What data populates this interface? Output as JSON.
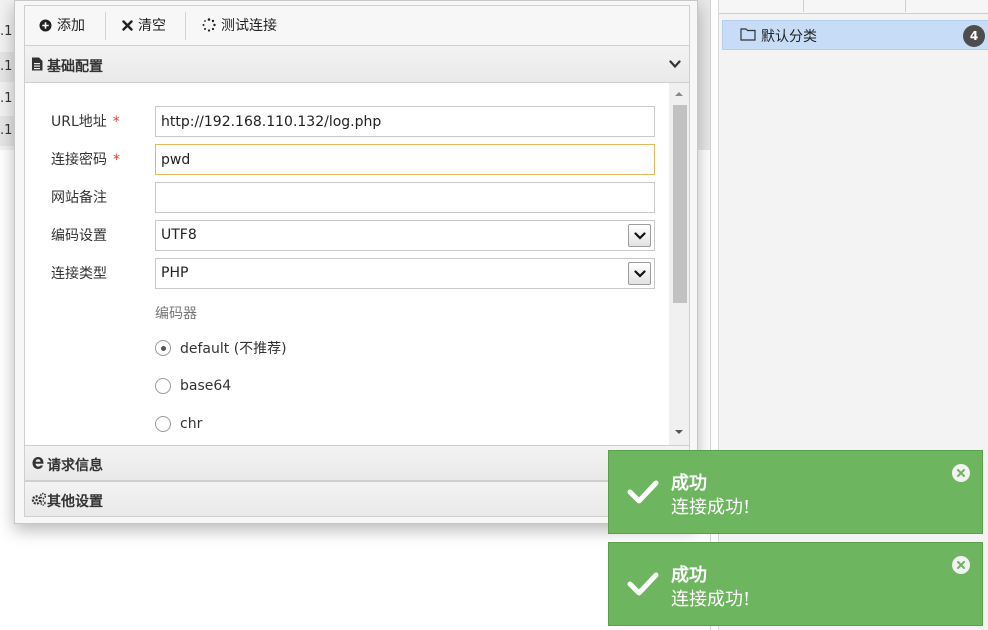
{
  "toolbar": {
    "add_label": "添加",
    "clear_label": "清空",
    "test_label": "测试连接"
  },
  "sections": {
    "basic_title": "基础配置",
    "request_title": "请求信息",
    "other_title": "其他设置"
  },
  "form": {
    "url_label": "URL地址",
    "url_value": "http://192.168.110.132/log.php",
    "password_label": "连接密码",
    "password_value": "pwd",
    "note_label": "网站备注",
    "note_value": "",
    "encoding_label": "编码设置",
    "encoding_value": "UTF8",
    "type_label": "连接类型",
    "type_value": "PHP",
    "required_mark": "*",
    "encoder_label": "编码器",
    "encoders": [
      {
        "label": "default (不推荐)",
        "checked": true
      },
      {
        "label": "base64",
        "checked": false
      },
      {
        "label": "chr",
        "checked": false
      }
    ]
  },
  "category_panel": {
    "item_label": "默认分类",
    "item_count": "4"
  },
  "background_list": {
    "rows": [
      ".1",
      ".1",
      ".1",
      ".1"
    ]
  },
  "toasts": [
    {
      "title": "成功",
      "message": "连接成功!"
    },
    {
      "title": "成功",
      "message": "连接成功!"
    }
  ],
  "colors": {
    "toast_green": "#6eb560",
    "selection_blue": "#c6dcf7",
    "required_red": "#e23b3b",
    "focus_border": "#e6b85c"
  }
}
